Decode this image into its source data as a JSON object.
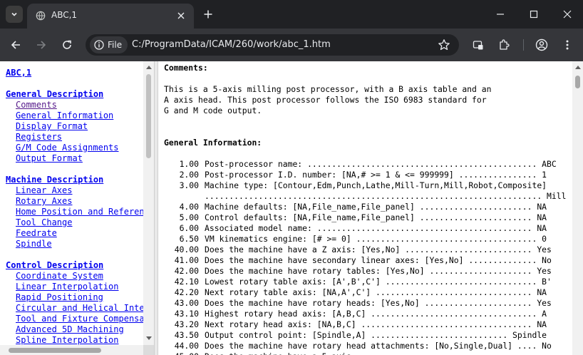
{
  "browser": {
    "tab_title": "ABC,1",
    "chip_label": "File",
    "url": "C:/ProgramData/ICAM/260/work/abc_1.htm"
  },
  "nav": {
    "title": "ABC,1",
    "groups": [
      {
        "label": "General Description",
        "items": [
          "Comments",
          "General Information",
          "Display Format",
          "Registers",
          "G/M Code Assignments",
          "Output Format"
        ]
      },
      {
        "label": "Machine Description",
        "items": [
          "Linear Axes",
          "Rotary Axes",
          "Home Position and Referen",
          "Tool Change",
          "Feedrate",
          "Spindle"
        ]
      },
      {
        "label": "Control Description",
        "items": [
          "Coordinate System",
          "Linear Interpolation",
          "Rapid Positioning",
          "Circular and Helical Inte",
          "Tool and Fixture Compensa",
          "Advanced 5D Machining",
          "Spline Interpolation"
        ]
      }
    ]
  },
  "main": {
    "comments_heading": "Comments:",
    "comments_text": "This is a 5-axis milling post processor, with a B axis table and an\nA axis head. This post processor follows the ISO 6983 standard for\nG and M code output.",
    "general_heading": "General Information:",
    "rows": [
      {
        "num": "1.00",
        "text": "Post-processor name: ............................................... ABC"
      },
      {
        "num": "2.00",
        "text": "Post-processor I.D. number: [NA,# >= 1 & <= 999999] ................ 1"
      },
      {
        "num": "3.00",
        "text": "Machine type: [Contour,Edm,Punch,Lathe,Mill-Turn,Mill,Robot,Composite]"
      },
      {
        "num": "",
        "text": "..................................................................... Mill"
      },
      {
        "num": "4.00",
        "text": "Machine defaults: [NA,File_name,File_panel] ....................... NA"
      },
      {
        "num": "5.00",
        "text": "Control defaults: [NA,File_name,File_panel] ....................... NA"
      },
      {
        "num": "6.00",
        "text": "Associated model name: ............................................ NA"
      },
      {
        "num": "6.50",
        "text": "VM kinematics engine: [# >= 0] ..................................... 0"
      },
      {
        "num": "40.00",
        "text": "Does the machine have a Z axis: [Yes,No] .......................... Yes"
      },
      {
        "num": "41.00",
        "text": "Does the machine have secondary linear axes: [Yes,No] .............. No"
      },
      {
        "num": "42.00",
        "text": "Does the machine have rotary tables: [Yes,No] ..................... Yes"
      },
      {
        "num": "42.10",
        "text": "Lowest rotary table axis: [A',B',C'] ............................... B'"
      },
      {
        "num": "42.20",
        "text": "Next rotary table axis: [NA,A',C'] ................................ NA"
      },
      {
        "num": "43.00",
        "text": "Does the machine have rotary heads: [Yes,No] ...................... Yes"
      },
      {
        "num": "43.10",
        "text": "Highest rotary head axis: [A,B,C] .................................. A"
      },
      {
        "num": "43.20",
        "text": "Next rotary head axis: [NA,B,C] ................................... NA"
      },
      {
        "num": "43.50",
        "text": "Output control point: [Spindle,A] ............................ Spindle"
      },
      {
        "num": "44.00",
        "text": "Does the machine have rotary head attachments: [No,Single,Dual] .... No"
      },
      {
        "num": "45.00",
        "text": "Does the machine have a 5-axis ........................................"
      }
    ]
  },
  "colors": {
    "chrome_dark": "#202124",
    "chrome_tab": "#35363a",
    "link": "#0000ee",
    "visited": "#551a8b"
  },
  "icons": [
    "tab-list-icon",
    "globe-icon",
    "close-icon",
    "plus-icon",
    "minimize-icon",
    "maximize-icon",
    "back-icon",
    "forward-icon",
    "reload-icon",
    "info-icon",
    "star-icon",
    "tab-search-icon",
    "extensions-icon",
    "profile-icon",
    "menu-icon"
  ]
}
